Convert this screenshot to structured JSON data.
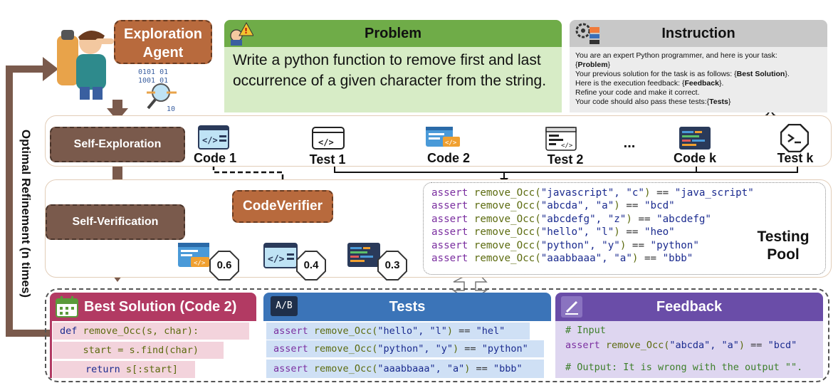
{
  "agent": {
    "label_line1": "Exploration",
    "label_line2": "Agent"
  },
  "problem": {
    "title": "Problem",
    "text": "Write a python function to remove first and last occurrence of a given character from the string."
  },
  "instruction": {
    "title": "Instruction",
    "lines": [
      {
        "pre": "You are an expert Python programmer, and here is your task:",
        "bold": "",
        "post": ""
      },
      {
        "pre": "{",
        "bold": "Problem",
        "post": "}"
      },
      {
        "pre": "Your previous solution for the task is as follows: {",
        "bold": "Best Solution",
        "post": "}."
      },
      {
        "pre": "Here is the execution feedback: {",
        "bold": "Feedback",
        "post": "}."
      },
      {
        "pre": "Refine your code and make it correct.",
        "bold": "",
        "post": ""
      },
      {
        "pre": "Your code should also pass these tests:{",
        "bold": "Tests",
        "post": "}"
      }
    ]
  },
  "loop_label": "Optimal Refinement (n times)",
  "stages": {
    "exploration": "Self-Exploration",
    "verification": "Self-Verification"
  },
  "exploration_items": {
    "code1": "Code 1",
    "test1": "Test 1",
    "code2": "Code 2",
    "test2": "Test 2",
    "ellipsis": "...",
    "codek": "Code k",
    "testk": "Test k"
  },
  "verifier": {
    "label": "CodeVerifier"
  },
  "scores": [
    "0.6",
    "0.4",
    "0.3"
  ],
  "testing_pool": {
    "label_line1": "Testing",
    "label_line2": "Pool",
    "asserts": [
      {
        "call": "remove_Occ(",
        "args": "\"javascript\", \"c\"",
        "expected": "\"java_script\""
      },
      {
        "call": "remove_Occ(",
        "args": "\"abcda\", \"a\"",
        "expected": "\"bcd\""
      },
      {
        "call": "remove_Occ(",
        "args": "\"abcdefg\", \"z\"",
        "expected": "\"abcdefg\""
      },
      {
        "call": "remove_Occ(",
        "args": "\"hello\", \"l\"",
        "expected": "\"heo\""
      },
      {
        "call": "remove_Occ(",
        "args": "\"python\", \"y\"",
        "expected": "\"python\""
      },
      {
        "call": "remove_Occ(",
        "args": "\"aaabbaaa\", \"a\"",
        "expected": "\"bbb\""
      }
    ]
  },
  "best_solution": {
    "title": "Best Solution (Code 2)",
    "lines": [
      {
        "kw": "def",
        "rest": " remove_Occ(s, char):"
      },
      {
        "kw": "",
        "rest": "    start = s.find(char)"
      },
      {
        "kw": "return",
        "rest": " s[:start]"
      }
    ]
  },
  "tests": {
    "title": "Tests",
    "badge": "A/B",
    "lines": [
      {
        "call": "remove_Occ(",
        "args": "\"hello\", \"l\"",
        "expected": "\"hel\""
      },
      {
        "call": "remove_Occ(",
        "args": "\"python\", \"y\"",
        "expected": "\"python\""
      },
      {
        "call": "remove_Occ(",
        "args": "\"aaabbaaa\", \"a\"",
        "expected": "\"bbb\""
      }
    ]
  },
  "feedback": {
    "title": "Feedback",
    "input_comment": "# Input",
    "input_call": "remove_Occ(",
    "input_args": "\"abcda\", \"a\"",
    "input_expected": "\"bcd\"",
    "output_comment": "# Output: It is wrong with the output \"\"."
  },
  "assert_kw": "assert",
  "eq_op": "==",
  "colors": {
    "agent": "#b86a3d",
    "problem": "#6fac48",
    "best": "#b23a63",
    "tests": "#3b74b8",
    "feedback": "#6a4da8",
    "stage": "#7a5a4c"
  }
}
